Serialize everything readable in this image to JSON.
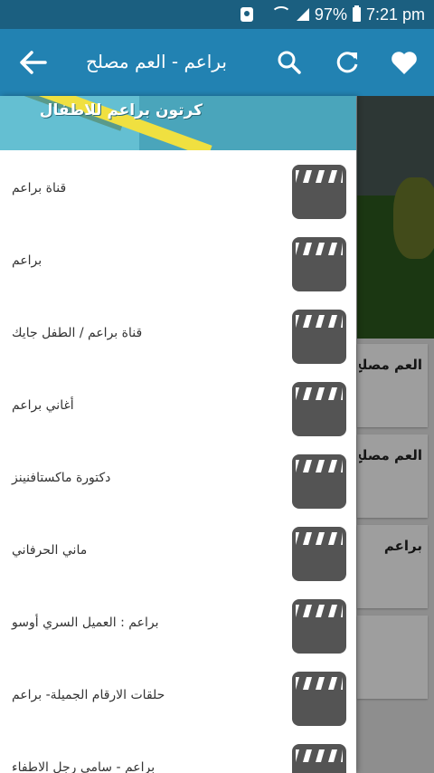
{
  "status_bar": {
    "battery": "97%",
    "time": "7:21 pm",
    "icons": [
      "notification-icon",
      "wifi-icon",
      "signal-icon",
      "battery-icon"
    ]
  },
  "app_bar": {
    "title": "براعم - العم مصلح",
    "icons": [
      "back-arrow-icon",
      "search-icon",
      "refresh-icon",
      "heart-icon"
    ]
  },
  "drawer": {
    "header_text": "كرتون براعم للاطفال",
    "items": [
      {
        "label": "قناة براعم",
        "icon": "clapperboard-icon"
      },
      {
        "label": "براعم",
        "icon": "clapperboard-icon"
      },
      {
        "label": "قناة براعم / الطفل جايك",
        "icon": "clapperboard-icon"
      },
      {
        "label": "أغاني براعم",
        "icon": "clapperboard-icon"
      },
      {
        "label": "دكتورة ماكستافنينز",
        "icon": "clapperboard-icon"
      },
      {
        "label": "ماني الحرفاني",
        "icon": "clapperboard-icon"
      },
      {
        "label": "براعم : العميل السري أوسو",
        "icon": "clapperboard-icon"
      },
      {
        "label": "حلقات الارقام الجميلة- براعم",
        "icon": "clapperboard-icon"
      },
      {
        "label": "براعم - سامي رجل الاطفاء",
        "icon": "clapperboard-icon"
      }
    ]
  },
  "background": {
    "cards": [
      "العم مصلح",
      "العم مصلح",
      "براعم"
    ]
  },
  "colors": {
    "status_bar": "#1b5f80",
    "app_bar": "#2282b2",
    "clapper": "#545454"
  }
}
